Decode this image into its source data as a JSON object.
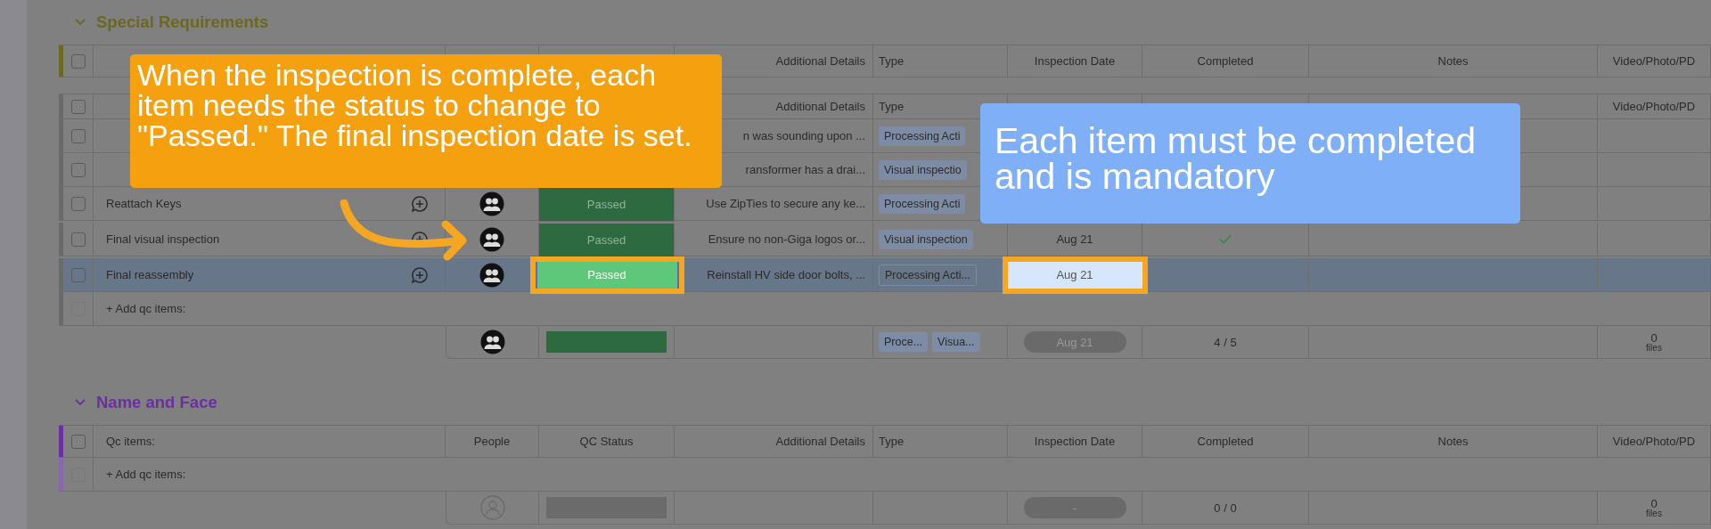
{
  "groups": [
    {
      "title": "Special Requirements",
      "color": "#6b6820",
      "header_rows": [
        {
          "accent": true,
          "checked": false,
          "cells": {
            "details": "Additional Details",
            "type": "Type",
            "date": "Inspection Date",
            "completed": "Completed",
            "notes": "Notes",
            "files": "Video/Photo/PD"
          }
        },
        {
          "accent": false,
          "checked": false,
          "cells": {
            "details": "Additional Details",
            "type": "Type",
            "files": "Video/Photo/PD"
          }
        }
      ],
      "rows": [
        {
          "selected": false,
          "checked": false,
          "details": "n was sounding upon ...",
          "type": "Processing Acti"
        },
        {
          "selected": false,
          "checked": false,
          "details": "ransformer has a drai...",
          "type": "Visual inspectio"
        },
        {
          "selected": false,
          "checked": false,
          "name": "Reattach Keys",
          "chat": true,
          "people": true,
          "status": "Passed",
          "highlighted": false,
          "details": "Use ZipTies to secure any ke...",
          "type": "Processing Acti"
        },
        {
          "selected": false,
          "checked": false,
          "name": "Final visual inspection",
          "chat": true,
          "people": true,
          "status": "Passed",
          "highlighted": false,
          "details": "Ensure no non-Giga logos or...",
          "type": "Visual inspection",
          "date": "Aug 21",
          "completed": true
        },
        {
          "selected": true,
          "checked": false,
          "name": "Final reassembly",
          "chat": true,
          "people": true,
          "status": "Passed",
          "highlighted": true,
          "details": "Reinstall HV side door bolts, ...",
          "type": "Processing Acti...",
          "date": "Aug 21",
          "completed": false
        }
      ],
      "add_row": {
        "label": "+ Add qc items:",
        "checked": false
      },
      "summary": {
        "people_assigned": true,
        "status_bar": {
          "color": "#2d6a3f"
        },
        "types": [
          "Proce...",
          "Visua..."
        ],
        "date": "Aug 21",
        "completed": "4 / 5",
        "files_count": "0",
        "files_label": "files"
      }
    },
    {
      "title": "Name and Face",
      "color": "#6a2fa0",
      "header_rows": [
        {
          "accent": true,
          "checked": false,
          "cells": {
            "name": "Qc items:",
            "people": "People",
            "status": "QC Status",
            "details": "Additional Details",
            "type": "Type",
            "date": "Inspection Date",
            "completed": "Completed",
            "notes": "Notes",
            "files": "Video/Photo/PD"
          }
        }
      ],
      "add_row": {
        "label": "+ Add qc items:",
        "checked": false
      },
      "summary": {
        "people_assigned": false,
        "status_bar": {
          "color": "#6b6b6b"
        },
        "date": "-",
        "completed": "0 / 0",
        "files_count": "0",
        "files_label": "files"
      }
    }
  ],
  "callouts": [
    {
      "text": "When the inspection is complete, each item needs the status to change to \"Passed.\" The final inspection date is set.",
      "color": "#f5a00f"
    },
    {
      "text": "Each item must be completed and is mandatory",
      "color": "#7fb0f7"
    }
  ]
}
